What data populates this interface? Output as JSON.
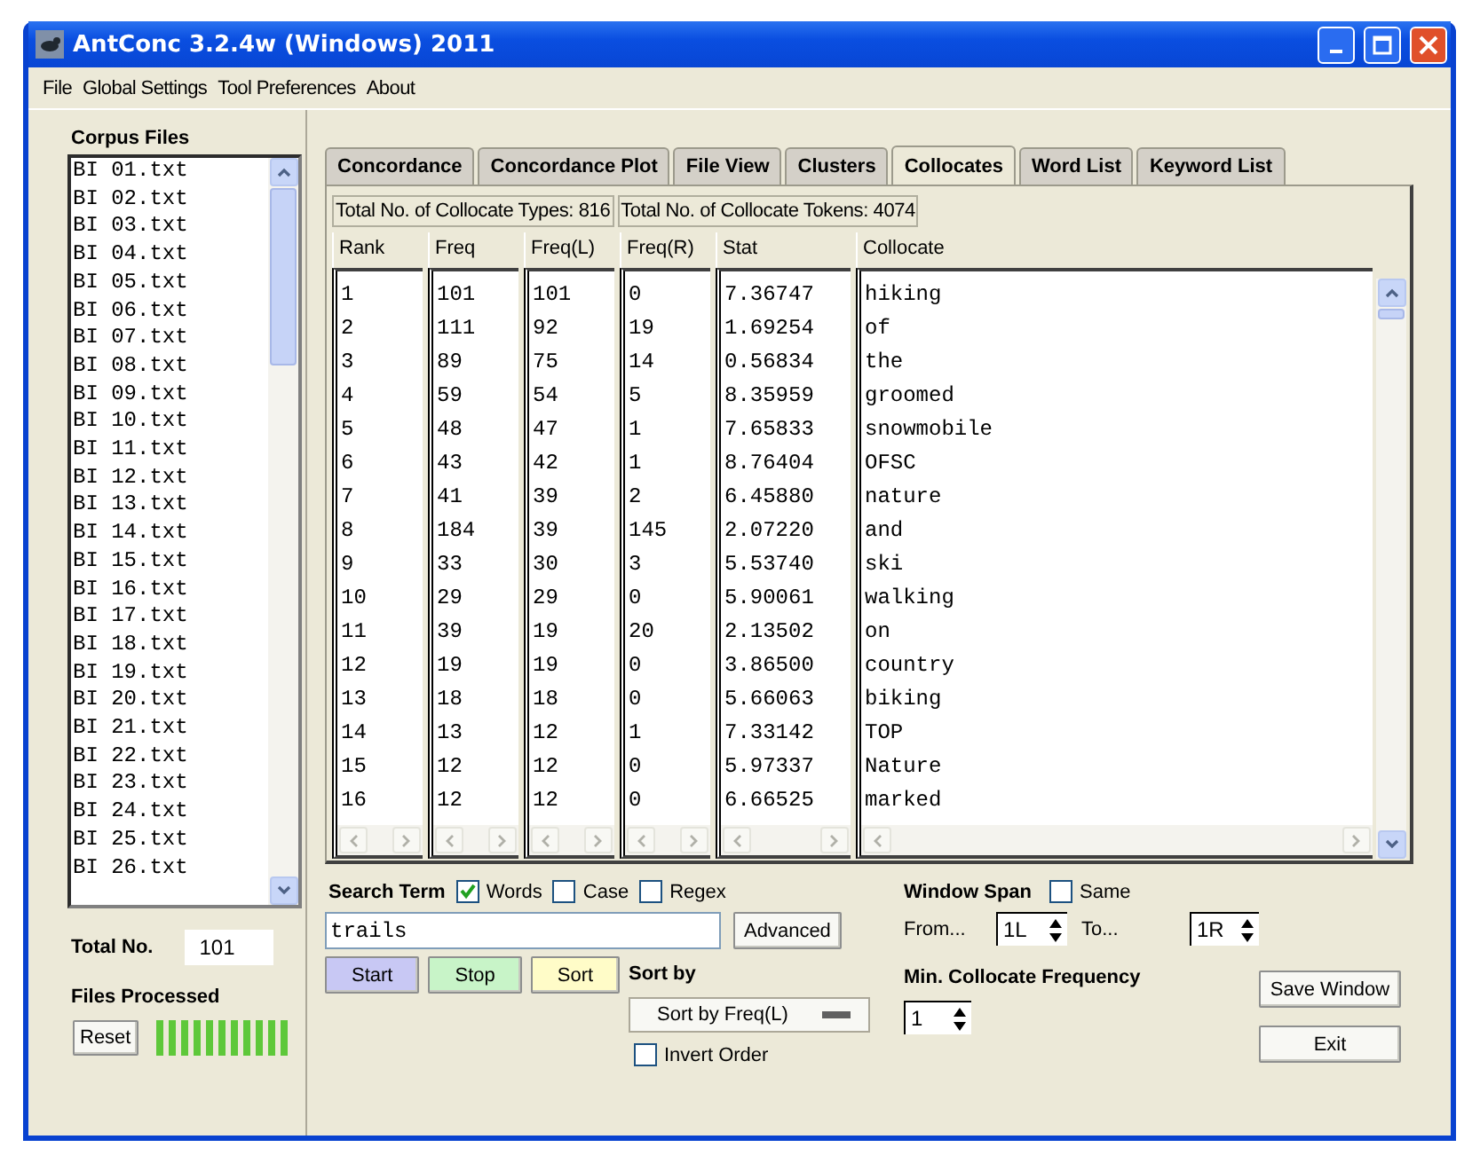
{
  "window": {
    "title": "AntConc 3.2.4w (Windows) 2011"
  },
  "menu": [
    "File",
    "Global Settings",
    "Tool Preferences",
    "About"
  ],
  "corpus": {
    "heading": "Corpus Files",
    "files": [
      "BI 01.txt",
      "BI 02.txt",
      "BI 03.txt",
      "BI 04.txt",
      "BI 05.txt",
      "BI 06.txt",
      "BI 07.txt",
      "BI 08.txt",
      "BI 09.txt",
      "BI 10.txt",
      "BI 11.txt",
      "BI 12.txt",
      "BI 13.txt",
      "BI 14.txt",
      "BI 15.txt",
      "BI 16.txt",
      "BI 17.txt",
      "BI 18.txt",
      "BI 19.txt",
      "BI 20.txt",
      "BI 21.txt",
      "BI 22.txt",
      "BI 23.txt",
      "BI 24.txt",
      "BI 25.txt",
      "BI 26.txt"
    ],
    "total_label": "Total No.",
    "total": "101",
    "processed_label": "Files Processed",
    "reset": "Reset",
    "progress": {
      "level": 1
    }
  },
  "tabs": [
    {
      "label": "Concordance",
      "selected": false
    },
    {
      "label": "Concordance Plot",
      "selected": false
    },
    {
      "label": "File View",
      "selected": false
    },
    {
      "label": "Clusters",
      "selected": false
    },
    {
      "label": "Collocates",
      "selected": true
    },
    {
      "label": "Word List",
      "selected": false
    },
    {
      "label": "Keyword List",
      "selected": false
    }
  ],
  "totals": [
    "Total No. of Collocate Types: 816",
    "Total No. of Collocate Tokens: 4074"
  ],
  "table": {
    "columns": [
      "Rank",
      "Freq",
      "Freq(L)",
      "Freq(R)",
      "Stat",
      "Collocate"
    ],
    "rows": [
      [
        "1",
        "101",
        "101",
        "0",
        "7.36747",
        "hiking"
      ],
      [
        "2",
        "111",
        "92",
        "19",
        "1.69254",
        "of"
      ],
      [
        "3",
        "89",
        "75",
        "14",
        "0.56834",
        "the"
      ],
      [
        "4",
        "59",
        "54",
        "5",
        "8.35959",
        "groomed"
      ],
      [
        "5",
        "48",
        "47",
        "1",
        "7.65833",
        "snowmobile"
      ],
      [
        "6",
        "43",
        "42",
        "1",
        "8.76404",
        "OFSC"
      ],
      [
        "7",
        "41",
        "39",
        "2",
        "6.45880",
        "nature"
      ],
      [
        "8",
        "184",
        "39",
        "145",
        "2.07220",
        "and"
      ],
      [
        "9",
        "33",
        "30",
        "3",
        "5.53740",
        "ski"
      ],
      [
        "10",
        "29",
        "29",
        "0",
        "5.90061",
        "walking"
      ],
      [
        "11",
        "39",
        "19",
        "20",
        "2.13502",
        "on"
      ],
      [
        "12",
        "19",
        "19",
        "0",
        "3.86500",
        "country"
      ],
      [
        "13",
        "18",
        "18",
        "0",
        "5.66063",
        "biking"
      ],
      [
        "14",
        "13",
        "12",
        "1",
        "7.33142",
        "TOP"
      ],
      [
        "15",
        "12",
        "12",
        "0",
        "5.97337",
        "Nature"
      ],
      [
        "16",
        "12",
        "12",
        "0",
        "6.66525",
        "marked"
      ]
    ]
  },
  "search": {
    "heading": "Search Term",
    "options": [
      {
        "label": "Words",
        "checked": true
      },
      {
        "label": "Case",
        "checked": false
      },
      {
        "label": "Regex",
        "checked": false
      }
    ],
    "value": "trails",
    "advanced": "Advanced",
    "actions": [
      {
        "label": "Start",
        "color": "#c8c8f4"
      },
      {
        "label": "Stop",
        "color": "#c8f4c8"
      },
      {
        "label": "Sort",
        "color": "#fffcc8"
      }
    ]
  },
  "sort": {
    "heading": "Sort by",
    "selection": "Sort by Freq(L)",
    "invert": {
      "label": "Invert Order",
      "checked": false
    }
  },
  "window_span": {
    "heading": "Window Span",
    "same": {
      "label": "Same",
      "checked": false
    },
    "from_label": "From...",
    "from": "1L",
    "to_label": "To...",
    "to": "1R"
  },
  "min_freq": {
    "heading": "Min. Collocate Frequency",
    "value": "1"
  },
  "buttons": [
    "Save Window",
    "Exit"
  ]
}
